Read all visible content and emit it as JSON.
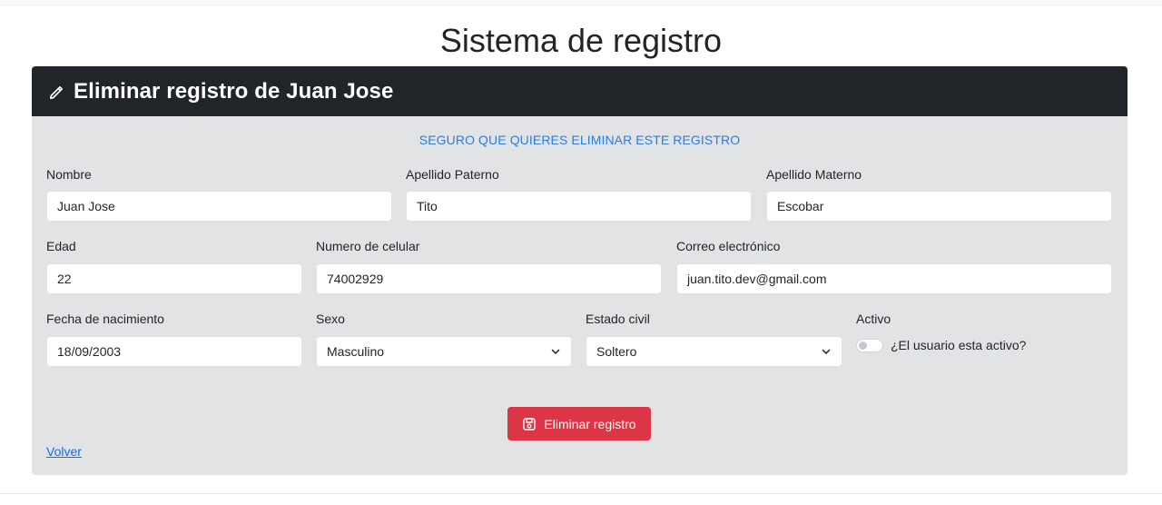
{
  "page": {
    "title": "Sistema de registro"
  },
  "card": {
    "header_title": "Eliminar registro de Juan Jose",
    "header_icon": "pencil-icon",
    "warning": "SEGURO QUE QUIERES ELIMINAR ESTE REGISTRO"
  },
  "fields": {
    "nombre": {
      "label": "Nombre",
      "value": "Juan Jose"
    },
    "apellido_paterno": {
      "label": "Apellido Paterno",
      "value": "Tito"
    },
    "apellido_materno": {
      "label": "Apellido Materno",
      "value": "Escobar"
    },
    "edad": {
      "label": "Edad",
      "value": "22"
    },
    "celular": {
      "label": "Numero de celular",
      "value": "74002929"
    },
    "correo": {
      "label": "Correo electrónico",
      "value": "juan.tito.dev@gmail.com"
    },
    "fecha_nacimiento": {
      "label": "Fecha de nacimiento",
      "value": "18/09/2003"
    },
    "sexo": {
      "label": "Sexo",
      "value": "Masculino"
    },
    "estado_civil": {
      "label": "Estado civil",
      "value": "Soltero"
    },
    "activo": {
      "label": "Activo",
      "switch_label": "¿El usuario esta activo?",
      "checked": false
    }
  },
  "actions": {
    "delete_label": "Eliminar registro",
    "delete_icon": "save-icon",
    "back_label": "Volver"
  },
  "colors": {
    "header_bg": "#212529",
    "card_bg": "#e2e3e5",
    "warning_text": "#2f7bd8",
    "danger": "#dc3545",
    "link": "#0d6efd"
  }
}
